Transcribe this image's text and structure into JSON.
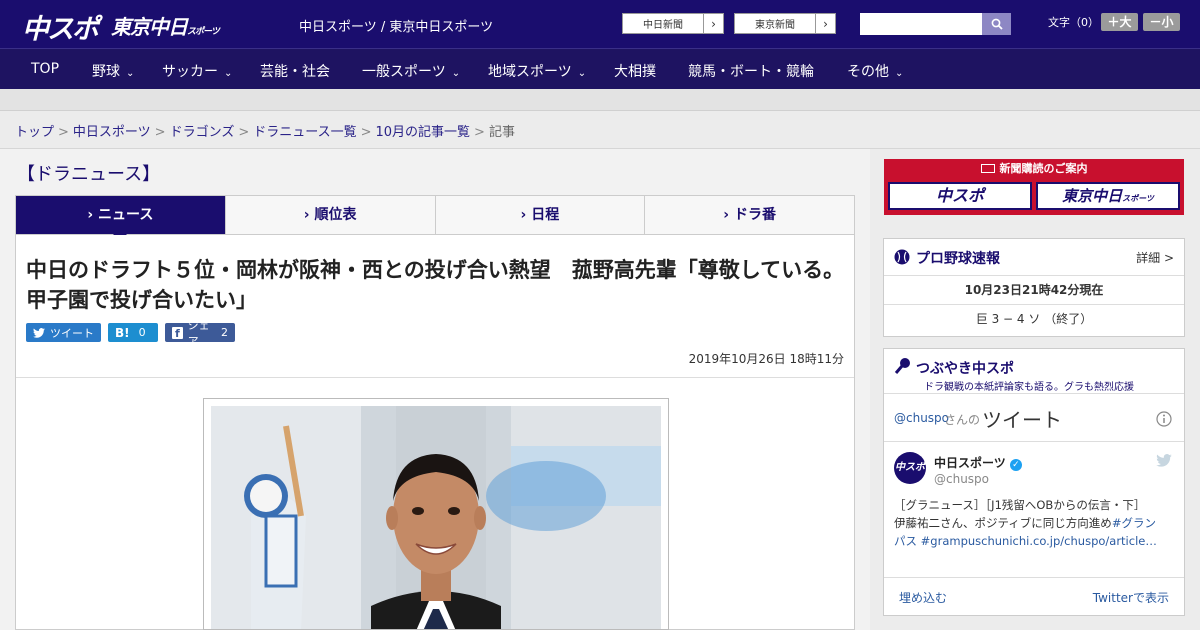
{
  "header": {
    "logo_main": "中スポ",
    "logo_tokyo": "東京中日",
    "logo_sub": "スポーツ",
    "site_links": "中日スポーツ / 東京中日スポーツ",
    "chunichi_btn": "中日新聞",
    "tokyo_btn": "東京新聞",
    "arrow": "›",
    "font_label": "文字（0）",
    "font_plus": "＋大",
    "font_minus": "－小"
  },
  "nav": [
    {
      "label": "TOP",
      "chev": ""
    },
    {
      "label": "野球",
      "chev": "⌄"
    },
    {
      "label": "サッカー",
      "chev": "⌄"
    },
    {
      "label": "芸能・社会",
      "chev": ""
    },
    {
      "label": "一般スポーツ",
      "chev": "⌄"
    },
    {
      "label": "地域スポーツ",
      "chev": "⌄"
    },
    {
      "label": "大相撲",
      "chev": ""
    },
    {
      "label": "競馬・ボート・競輪",
      "chev": ""
    },
    {
      "label": "その他",
      "chev": "⌄"
    }
  ],
  "breadcrumb": [
    "トップ",
    "中日スポーツ",
    "ドラゴンズ",
    "ドラニュース一覧",
    "10月の記事一覧",
    "記事"
  ],
  "breadcrumb_sep": ">",
  "section_title": "【ドラニュース】",
  "tabs": [
    "ニュース",
    "順位表",
    "日程",
    "ドラ番"
  ],
  "tab_prefix": "›",
  "article": {
    "headline": "中日のドラフト５位・岡林が阪神・西との投げ合い熱望　菰野高先輩「尊敬している。甲子園で投げ合いたい」",
    "tweet_label": "ツイート",
    "hatena_label": "B!",
    "hatena_count": "0",
    "share_label": "シェア",
    "share_count": "2",
    "date": "2019年10月26日 18時11分"
  },
  "sidebar": {
    "banner_title": "新聞購読のご案内",
    "banner_chuspo": "中スポ",
    "banner_tokyo": "東京中日",
    "banner_tokyo_sub": "スポーツ",
    "baseball_title": "プロ野球速報",
    "baseball_detail": "詳細 >",
    "baseball_time": "10月23日21時42分現在",
    "baseball_score": "巨 3 − 4 ソ （終了）",
    "tweet_box_title": "つぶやき中スポ",
    "tweet_box_sub": "ドラ観戦の本紙評論家も語る。グラも熱烈応援",
    "tweets_handle": "@chuspo",
    "tweets_of": "さんの",
    "tweets_label": "ツイート",
    "account_name": "中日スポーツ",
    "account_handle": "@chuspo",
    "tweet_line1": "［グラニュース］［J1残留へOBからの伝言・下］",
    "tweet_line2_a": "伊藤祐二さん、ポジティブに同じ方向進め",
    "tweet_line2_tag": "#グラン",
    "tweet_line3": "パス #grampuschunichi.co.jp/chuspo/article…",
    "embed_label": "埋め込む",
    "view_on_twitter": "Twitterで表示"
  },
  "colors": {
    "brand_navy": "#1a0d6e",
    "banner_red": "#c8102e",
    "twitter_blue": "#1da1f2"
  }
}
